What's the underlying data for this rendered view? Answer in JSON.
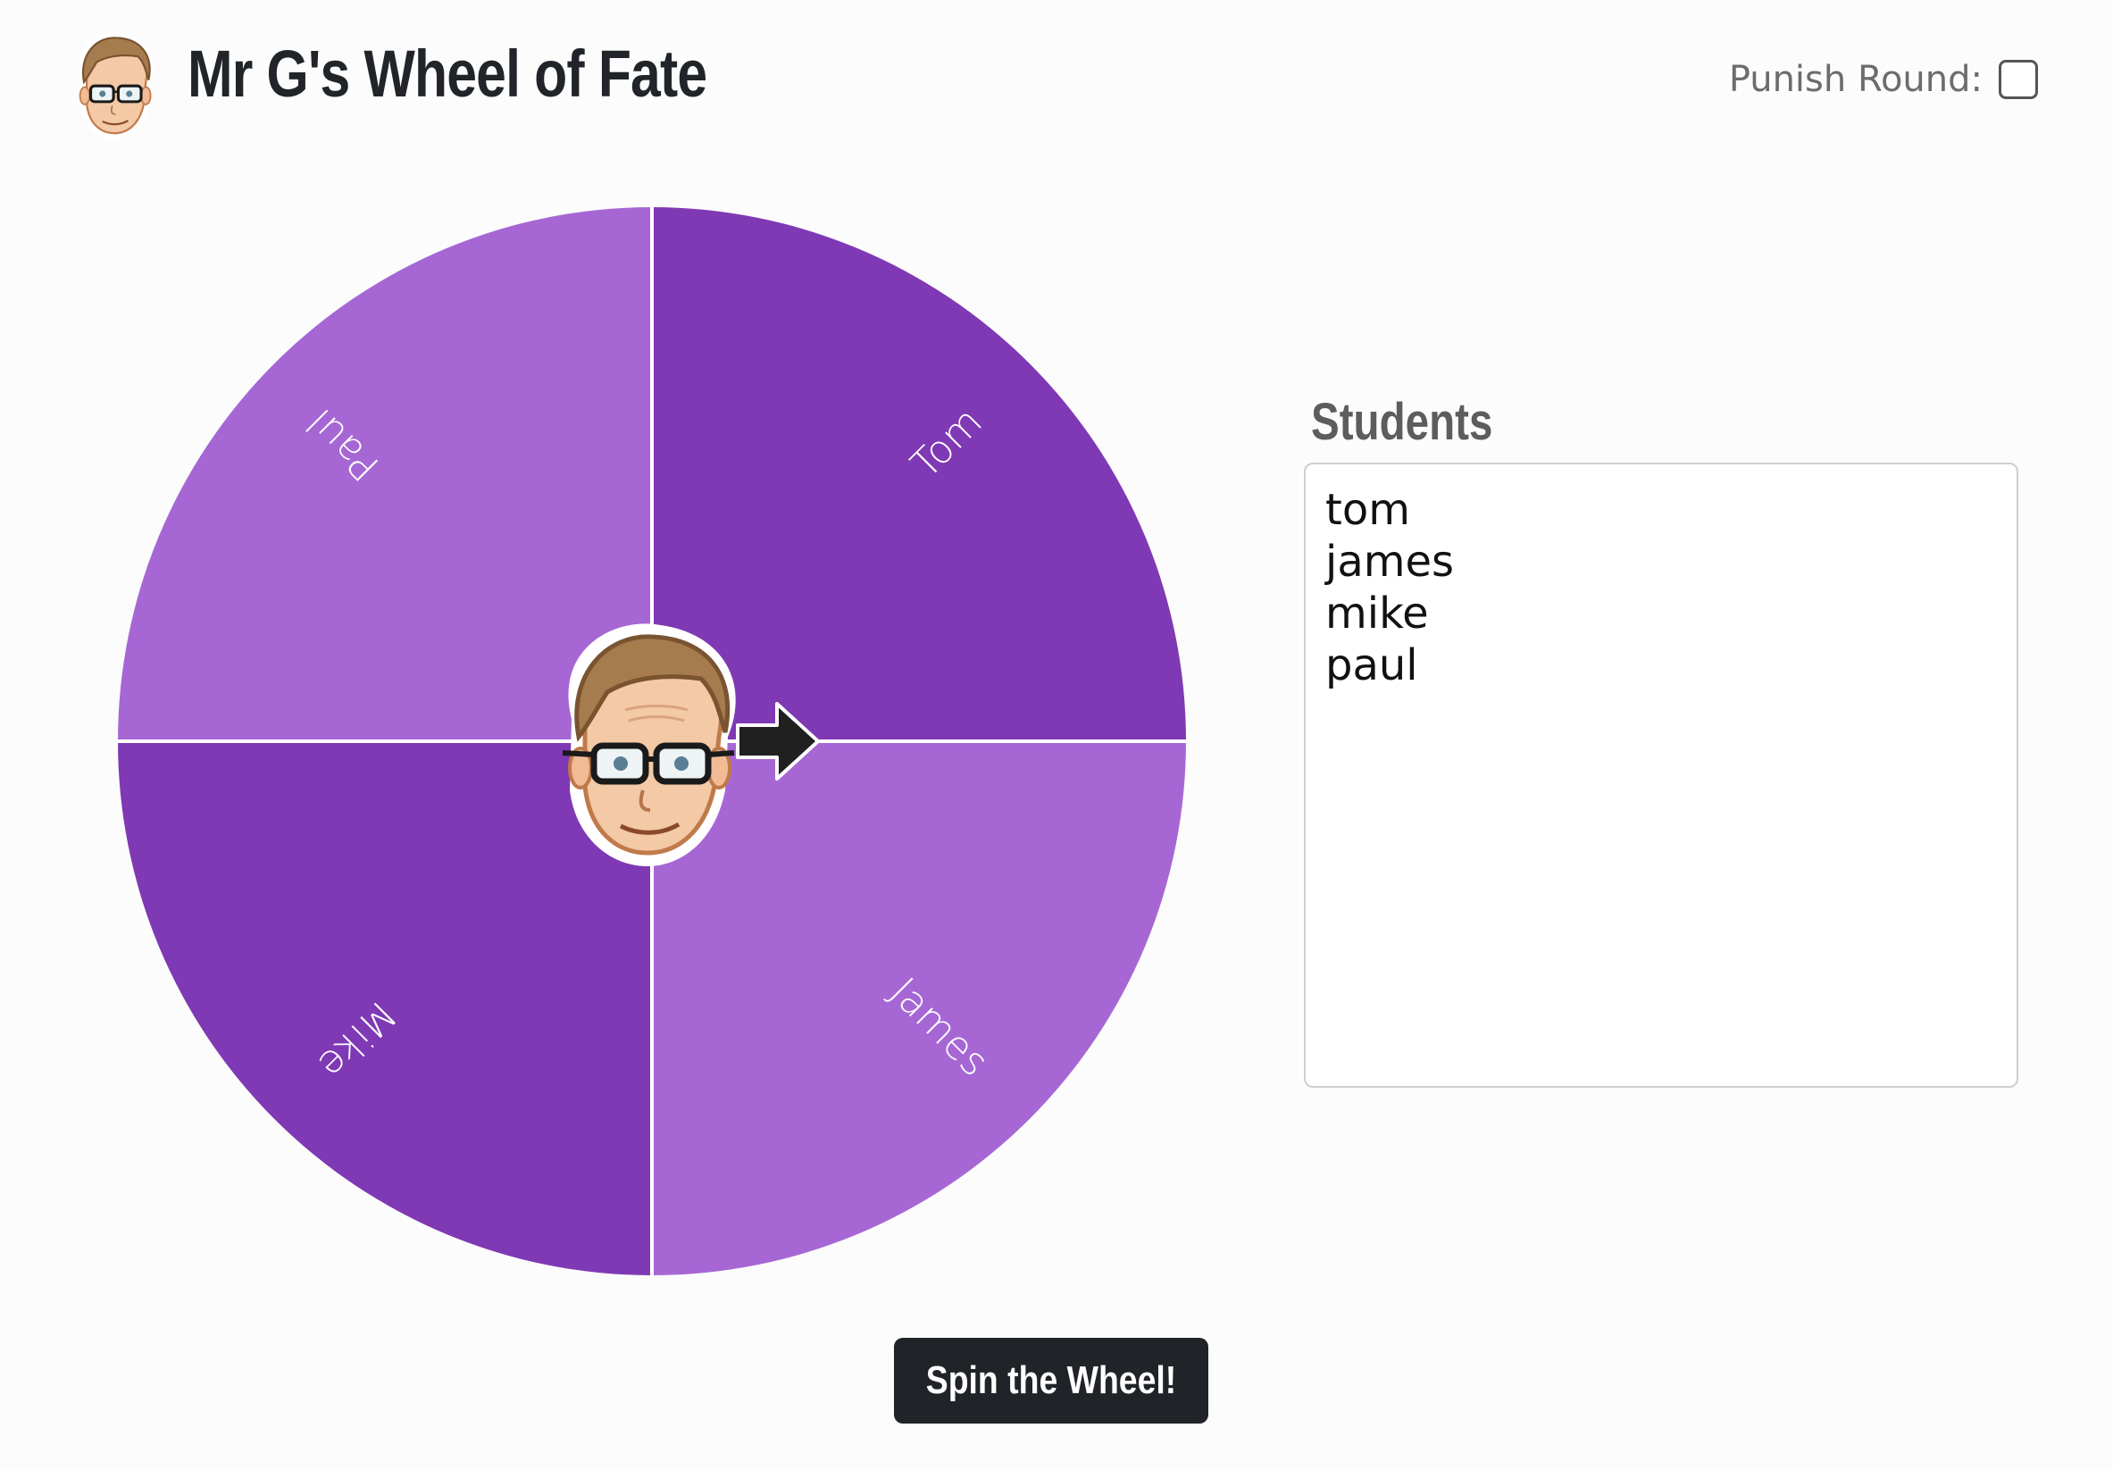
{
  "header": {
    "title": "Mr G's Wheel of Fate",
    "logo_icon": "cartoon-face-icon",
    "punish_round_label": "Punish Round:",
    "punish_round_checked": false
  },
  "wheel": {
    "segments": [
      {
        "label": "Tom",
        "color": "#7f39b4"
      },
      {
        "label": "James",
        "color": "#a667d5"
      },
      {
        "label": "Mike",
        "color": "#7f39b4"
      },
      {
        "label": "Paul",
        "color": "#a667d5"
      }
    ],
    "center_icon": "cartoon-face-icon",
    "pointer_icon": "arrow-right-icon"
  },
  "students": {
    "heading": "Students",
    "names": [
      "tom",
      "james",
      "mike",
      "paul"
    ]
  },
  "actions": {
    "spin_label": "Spin the Wheel!"
  },
  "colors": {
    "dark_segment": "#7f39b4",
    "light_segment": "#a667d5",
    "button_bg": "#202327"
  }
}
